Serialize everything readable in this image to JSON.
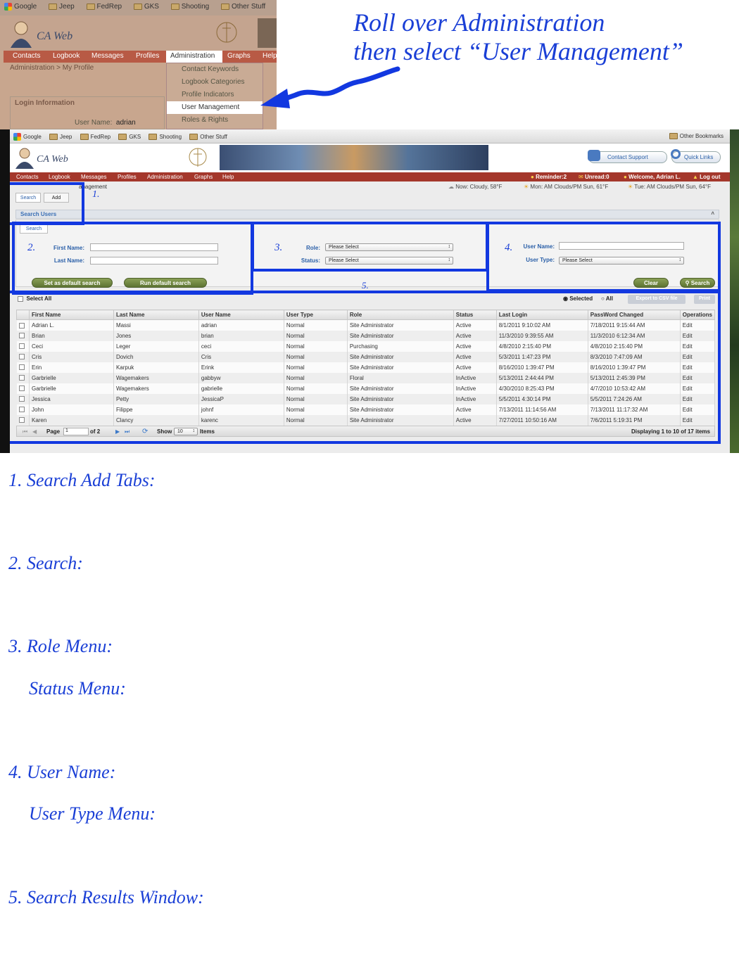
{
  "top_zoom": {
    "bookmarks": [
      "Google",
      "Jeep",
      "FedRep",
      "GKS",
      "Shooting",
      "Other Stuff"
    ],
    "app_name": "CA Web",
    "nav": [
      "Contacts",
      "Logbook",
      "Messages",
      "Profiles",
      "Administration",
      "Graphs",
      "Help"
    ],
    "breadcrumb": "Administration > My Profile",
    "admin_menu": [
      "Contact Keywords",
      "Logbook Categories",
      "Profile Indicators",
      "User Management",
      "Roles & Rights"
    ],
    "login_box_title": "Login Information",
    "user_name_label": "User Name:",
    "user_name_value": "adrian"
  },
  "callout": {
    "line1": "Roll over Administration",
    "line2": "then select “User Management”"
  },
  "app": {
    "bookmarks": [
      "Google",
      "Jeep",
      "FedRep",
      "GKS",
      "Shooting",
      "Other Stuff"
    ],
    "other_bookmarks": "Other Bookmarks",
    "app_name": "CA Web",
    "contact_support": "Contact Support",
    "quick_links": "Quick Links",
    "nav": [
      "Contacts",
      "Logbook",
      "Messages",
      "Profiles",
      "Administration",
      "Graphs",
      "Help"
    ],
    "reminder": "Reminder:2",
    "unread": "Unread:0",
    "welcome": "Welcome, Adrian L.",
    "logout": "Log out",
    "breadcrumb_fragment": "anagement",
    "weather_now": "Now: Cloudy, 58°F",
    "weather_mon": "Mon: AM Clouds/PM Sun, 61°F",
    "weather_tue": "Tue: AM Clouds/PM Sun, 64°F",
    "tab_search": "Search",
    "tab_add": "Add",
    "section_title": "Search Users",
    "subtab_search": "Search",
    "first_name_label": "First Name:",
    "last_name_label": "Last Name:",
    "role_label": "Role:",
    "status_label": "Status:",
    "role_value": "Please Select",
    "status_value": "Please Select",
    "user_name_label": "User Name:",
    "user_type_label": "User Type:",
    "user_type_value": "Please Select",
    "set_default": "Set as default search",
    "run_default": "Run default search",
    "clear": "Clear",
    "search": "Search",
    "select_all": "Select All",
    "radio_selected": "Selected",
    "radio_all": "All",
    "export": "Export to CSV file",
    "print": "Print",
    "columns": [
      "First Name",
      "Last Name",
      "User Name",
      "User Type",
      "Role",
      "Status",
      "Last Login",
      "PassWord Changed",
      "Operations"
    ],
    "rows": [
      [
        "Adrian L.",
        "Massi",
        "adrian",
        "Normal",
        "Site Administrator",
        "Active",
        "8/1/2011 9:10:02 AM",
        "7/18/2011 9:15:44 AM",
        "Edit"
      ],
      [
        "Brian",
        "Jones",
        "brian",
        "Normal",
        "Site Administrator",
        "Active",
        "11/3/2010 9:39:55 AM",
        "11/3/2010 6:12:34 AM",
        "Edit"
      ],
      [
        "Ceci",
        "Leger",
        "ceci",
        "Normal",
        "Purchasing",
        "Active",
        "4/8/2010 2:15:40 PM",
        "4/8/2010 2:15:40 PM",
        "Edit"
      ],
      [
        "Cris",
        "Dovich",
        "Cris",
        "Normal",
        "Site Administrator",
        "Active",
        "5/3/2011 1:47:23 PM",
        "8/3/2010 7:47:09 AM",
        "Edit"
      ],
      [
        "Erin",
        "Karpuk",
        "Erink",
        "Normal",
        "Site Administrator",
        "Active",
        "8/16/2010 1:39:47 PM",
        "8/16/2010 1:39:47 PM",
        "Edit"
      ],
      [
        "Garbrielle",
        "Wagemakers",
        "gabbyw",
        "Normal",
        "Floral",
        "InActive",
        "5/13/2011 2:44:44 PM",
        "5/13/2011 2:45:39 PM",
        "Edit"
      ],
      [
        "Garbrielle",
        "Wagemakers",
        "gabrielle",
        "Normal",
        "Site Administrator",
        "InActive",
        "4/30/2010 8:25:43 PM",
        "4/7/2010 10:53:42 AM",
        "Edit"
      ],
      [
        "Jessica",
        "Petty",
        "JessicaP",
        "Normal",
        "Site Administrator",
        "InActive",
        "5/5/2011 4:30:14 PM",
        "5/5/2011 7:24:26 AM",
        "Edit"
      ],
      [
        "John",
        "Filippe",
        "johnf",
        "Normal",
        "Site Administrator",
        "Active",
        "7/13/2011 11:14:56 AM",
        "7/13/2011 11:17:32 AM",
        "Edit"
      ],
      [
        "Karen",
        "Clancy",
        "karenc",
        "Normal",
        "Site Administrator",
        "Active",
        "7/27/2011 10:50:16 AM",
        "7/6/2011 5:19:31 PM",
        "Edit"
      ]
    ],
    "page_label": "Page",
    "page_value": "1",
    "page_of": "of 2",
    "show_label": "Show",
    "show_value": "10",
    "items_label": "Items",
    "displaying": "Displaying 1 to 10 of 17 items"
  },
  "annotations": [
    "1.",
    "2.",
    "3.",
    "4.",
    "5."
  ],
  "notes": {
    "n1": "1. Search Add Tabs:",
    "n2": "2. Search:",
    "n3a": "3. Role Menu:",
    "n3b": "Status Menu:",
    "n4a": "4. User Name:",
    "n4b": "User Type Menu:",
    "n5": "5. Search Results Window:"
  },
  "colors": {
    "annotation_blue": "#1238e0",
    "nav_red": "#a4372b",
    "button_green": "#6b8240",
    "link_blue": "#3a78c8"
  }
}
